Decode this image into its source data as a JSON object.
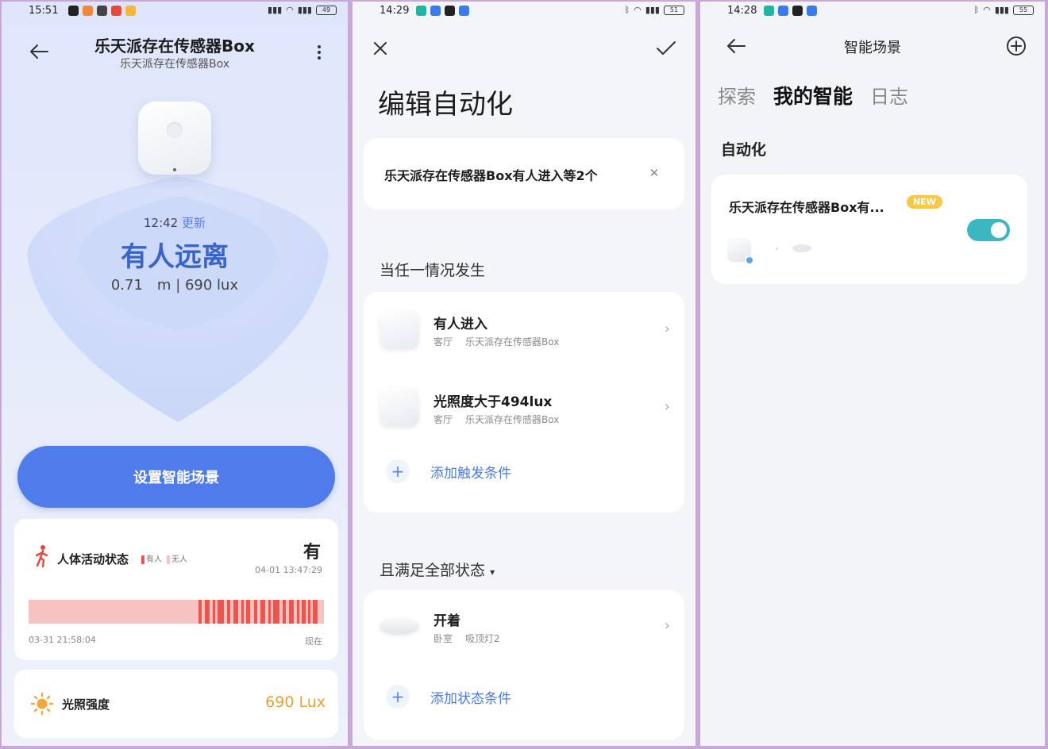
{
  "screen1": {
    "status_time": "15:51",
    "title": "乐天派存在传感器Box",
    "subtitle": "乐天派存在传感器Box",
    "update_time": "12:42",
    "update_label": "更新",
    "state": "有人远离",
    "metrics": "0.71　m | 690 lux",
    "setup_button": "设置智能场景",
    "activity": {
      "label": "人体活动状态",
      "legend_yes": "有人",
      "legend_no": "无人",
      "value": "有",
      "time": "04-01 13:47:29",
      "start": "03-31 21:58:04",
      "end": "现在"
    },
    "light": {
      "label": "光照强度",
      "value": "690 Lux"
    }
  },
  "screen2": {
    "status_time": "14:29",
    "heading": "编辑自动化",
    "automation_name": "乐天派存在传感器Box有人进入等2个",
    "trigger_section": "当任一情况发生",
    "triggers": [
      {
        "title": "有人进入",
        "room": "客厅",
        "device": "乐天派存在传感器Box"
      },
      {
        "title": "光照度大于494lux",
        "room": "客厅",
        "device": "乐天派存在传感器Box"
      }
    ],
    "add_trigger": "添加触发条件",
    "state_section": "且满足全部状态",
    "states": [
      {
        "title": "开着",
        "room": "卧室",
        "device": "吸顶灯2"
      }
    ],
    "add_state": "添加状态条件"
  },
  "screen3": {
    "status_time": "14:28",
    "title": "智能场景",
    "tabs": [
      "探索",
      "我的智能",
      "日志"
    ],
    "section": "自动化",
    "automation_name": "乐天派存在传感器Box有...",
    "new_badge": "NEW",
    "toggle_on": true
  },
  "colors": {
    "accent_blue": "#4f7cea",
    "state_blue": "#3a64c8",
    "toggle_teal": "#3cb7c2",
    "badge_yellow": "#f7c84a",
    "lux_orange": "#e7a13a",
    "activity_red": "#e9564f"
  }
}
